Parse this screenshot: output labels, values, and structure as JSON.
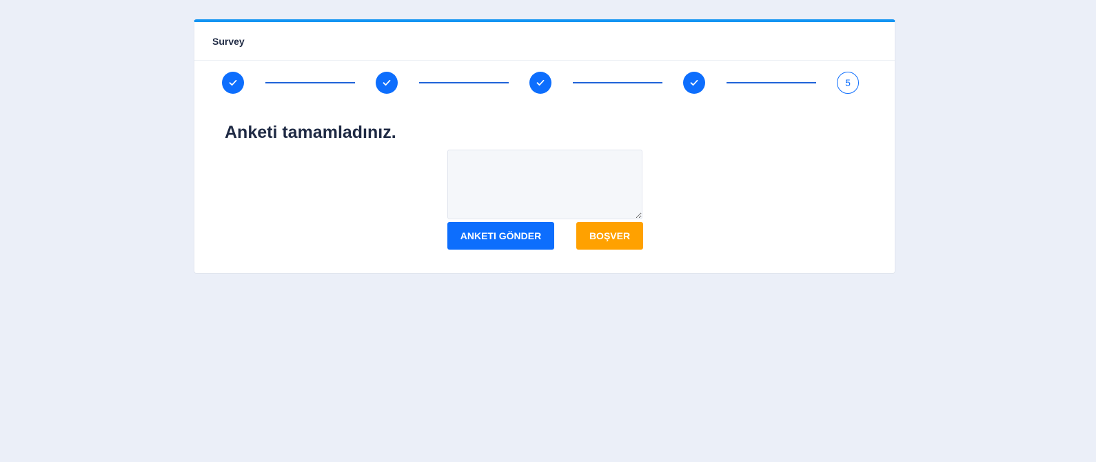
{
  "card": {
    "title": "Survey"
  },
  "stepper": {
    "steps": [
      {
        "state": "completed",
        "icon": "check-icon"
      },
      {
        "state": "completed",
        "icon": "check-icon"
      },
      {
        "state": "completed",
        "icon": "check-icon"
      },
      {
        "state": "completed",
        "icon": "check-icon"
      },
      {
        "state": "current",
        "label": "5"
      }
    ]
  },
  "main": {
    "heading": "Anketi tamamladınız.",
    "feedback_value": "",
    "submit_label": "ANKETI GÖNDER",
    "skip_label": "BOŞVER"
  },
  "colors": {
    "accent": "#0d6efd",
    "top_border": "#1394f2",
    "skip": "#ffa100",
    "background": "#ebeff8"
  }
}
